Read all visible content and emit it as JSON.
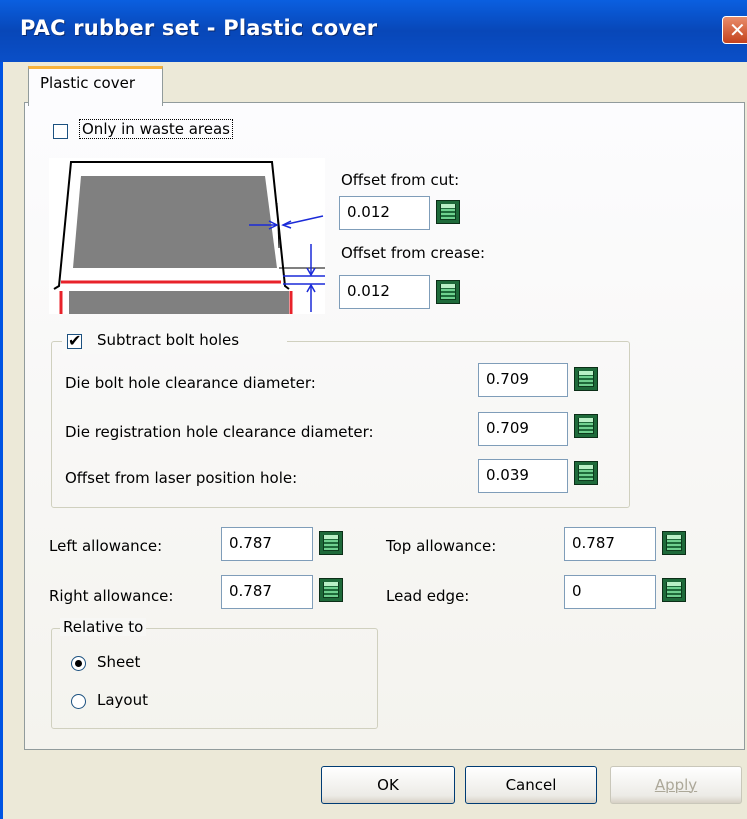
{
  "window": {
    "title": "PAC rubber set - Plastic cover",
    "close_glyph": "✕"
  },
  "tabs": [
    {
      "label": "Plastic cover",
      "selected": true
    }
  ],
  "only_waste": {
    "label": "Only in waste areas",
    "checked": false
  },
  "offset_from_cut": {
    "label": "Offset from cut:",
    "value": "0.012"
  },
  "offset_from_crease": {
    "label": "Offset from crease:",
    "value": "0.012"
  },
  "bolt_holes": {
    "label": "Subtract bolt holes",
    "checked": true,
    "check_glyph": "✔",
    "fields": [
      {
        "label": "Die bolt hole clearance diameter:",
        "value": "0.709"
      },
      {
        "label": "Die registration hole clearance diameter:",
        "value": "0.709"
      },
      {
        "label": "Offset from laser position hole:",
        "value": "0.039"
      }
    ]
  },
  "allowances": {
    "left": {
      "label": "Left allowance:",
      "value": "0.787"
    },
    "right": {
      "label": "Right allowance:",
      "value": "0.787"
    },
    "top": {
      "label": "Top allowance:",
      "value": "0.787"
    },
    "lead": {
      "label": "Lead edge:",
      "value": "0"
    }
  },
  "relative_to": {
    "legend": "Relative to",
    "options": [
      {
        "label": "Sheet",
        "selected": true
      },
      {
        "label": "Layout",
        "selected": false
      }
    ]
  },
  "buttons": {
    "ok": "OK",
    "cancel": "Cancel",
    "apply": "Apply"
  },
  "icons": {
    "calculator": "calculator-icon",
    "diagram": "offset-diagram-icon"
  },
  "colors": {
    "title_bar": "#0a5fe0",
    "diagram_red": "#e8222a",
    "diagram_blue": "#1a2ad8",
    "diagram_gray": "#808080"
  }
}
